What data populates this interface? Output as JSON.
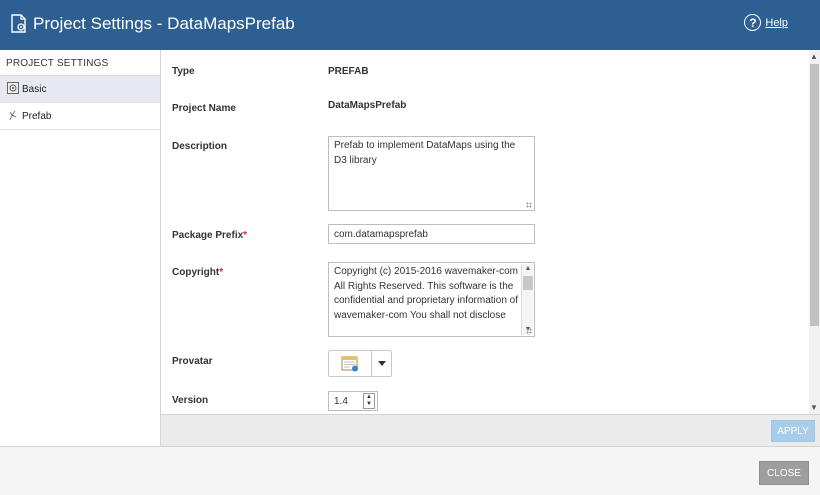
{
  "window": {
    "title": "Project Settings - DataMapsPrefab",
    "help_label": "Help",
    "help_glyph": "?"
  },
  "sidebar": {
    "header": "PROJECT SETTINGS",
    "items": [
      {
        "label": "Basic",
        "icon": "settings-panel-icon",
        "active": true
      },
      {
        "label": "Prefab",
        "icon": "prefab-icon",
        "active": false
      }
    ]
  },
  "form": {
    "type": {
      "label": "Type",
      "value": "PREFAB"
    },
    "project_name": {
      "label": "Project Name",
      "value": "DataMapsPrefab"
    },
    "description": {
      "label": "Description",
      "value": "Prefab to implement DataMaps using the D3 library"
    },
    "package_prefix": {
      "label": "Package Prefix",
      "required_mark": "*",
      "value": "com.datamapsprefab"
    },
    "copyright": {
      "label": "Copyright",
      "required_mark": "*",
      "value": "Copyright (c) 2015-2016 wavemaker-com All Rights Reserved. This software is the confidential and proprietary information of wavemaker-com You shall not disclose"
    },
    "provatar": {
      "label": "Provatar",
      "icon": "calendar-image-icon"
    },
    "version": {
      "label": "Version",
      "value": "1.4"
    }
  },
  "actions": {
    "apply_label": "APPLY",
    "close_label": "CLOSE"
  },
  "colors": {
    "titlebar": "#2d5f93",
    "apply_disabled": "#a9cde8",
    "close": "#9e9e9e",
    "required": "#d9232d"
  }
}
